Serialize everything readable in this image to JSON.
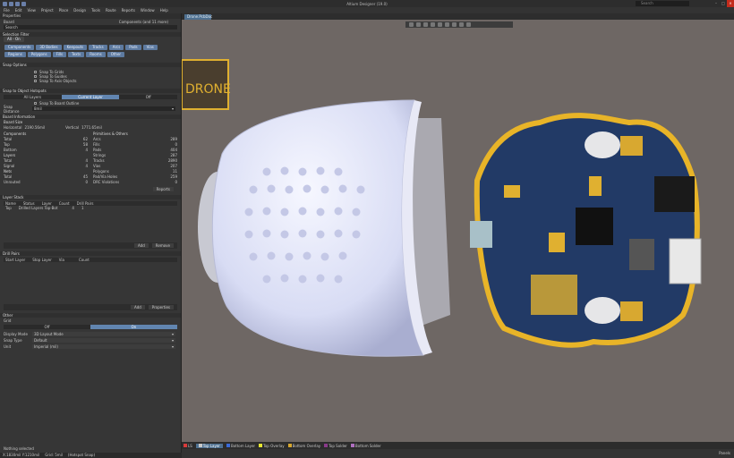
{
  "app": {
    "title": "Altium Designer (19.0)",
    "search_placeholder": "Search"
  },
  "menu": [
    "File",
    "Edit",
    "View",
    "Project",
    "Place",
    "Design",
    "Tools",
    "Route",
    "Reports",
    "Window",
    "Help"
  ],
  "panel": {
    "title": "Properties",
    "board_label": "Board",
    "components_count": "Components (and 11 more)",
    "search_placeholder": "Search",
    "selection_filter": {
      "title": "Selection Filter",
      "all_label": "All - On",
      "chips": [
        "Components",
        "3D Bodies",
        "Keepouts",
        "Tracks",
        "Arcs",
        "Pads",
        "Vias",
        "Regions",
        "Polygons",
        "Fills",
        "Texts",
        "Rooms",
        "Other"
      ]
    },
    "snap": {
      "title": "Snap Options",
      "options": [
        "Snap To Grids",
        "Snap To Guides",
        "Snap To Axis Objects"
      ]
    },
    "snap_objects": {
      "title": "Snap to Object Hotspots",
      "segments": [
        "All Layers",
        "Current Layer",
        "Off"
      ],
      "snap_board": "Snap To Board Outline",
      "snap_distance_label": "Snap Distance",
      "snap_distance": "8mil"
    },
    "board_info": {
      "title": "Board Information",
      "size_title": "Board Size",
      "horizontal_label": "Horizontal",
      "horizontal": "2190.56mil",
      "vertical_label": "Vertical",
      "vertical": "1771.65mil",
      "components_title": "Components",
      "components": [
        [
          "Total",
          "62"
        ],
        [
          "Top",
          "58"
        ],
        [
          "Bottom",
          "4"
        ]
      ],
      "layers_title": "Layers",
      "layers": [
        [
          "Total",
          "4"
        ],
        [
          "Signal",
          "4"
        ]
      ],
      "nets_title": "Nets",
      "nets": [
        [
          "Total",
          "45"
        ],
        [
          "Unrouted",
          "0"
        ]
      ],
      "primitives_title": "Primitives & Others",
      "primitives": [
        [
          "Arcs",
          "289"
        ],
        [
          "Fills",
          "0"
        ],
        [
          "Pads",
          "404"
        ],
        [
          "Strings",
          "287"
        ],
        [
          "Tracks",
          "2890"
        ],
        [
          "Vias",
          "207"
        ],
        [
          "Polygons",
          "11"
        ],
        [
          "Pad/Via Holes",
          "259"
        ],
        [
          "DRC Violations",
          "0"
        ]
      ],
      "report_button": "Reports"
    },
    "layers_table": {
      "title": "Layer Stack",
      "headers": [
        "Name",
        "Status",
        "Layer",
        "Count",
        "Drill Pairs"
      ],
      "rows": [
        [
          "Top",
          "Drilled Layers Top-Bot",
          "",
          "4",
          "1"
        ]
      ],
      "buttons": [
        "Add",
        "Remove"
      ]
    },
    "drill_table": {
      "title": "Drill Pairs",
      "headers": [
        "Start Layer",
        "Stop Layer",
        "Via",
        "",
        "Count"
      ],
      "buttons": [
        "Add",
        "Properties"
      ]
    },
    "other": {
      "title": "Other",
      "grid_label": "Grid",
      "segments": [
        "Off",
        "On"
      ],
      "fields": [
        [
          "Display Mode",
          "3D Layout Mode"
        ],
        [
          "Snap Type",
          "Default"
        ],
        [
          "Unit",
          "Imperial (mil)"
        ]
      ]
    },
    "nothing_selected": "Nothing selected",
    "status": [
      "X:1830mil Y:1210mil",
      "Grid: 5mil",
      "(Hotspot Snap)"
    ]
  },
  "document": {
    "tab": "Drone.PcbDoc",
    "logo_text": "DRONE",
    "layers": [
      {
        "name": "LS",
        "color": "#d83a3a"
      },
      {
        "name": "Top Layer",
        "color": "#c8c8c8"
      },
      {
        "name": "Bottom Layer",
        "color": "#3a6ad8"
      },
      {
        "name": "Top Overlay",
        "color": "#e6e632"
      },
      {
        "name": "Bottom Overlay",
        "color": "#d8a830"
      },
      {
        "name": "Top Solder",
        "color": "#8a3a8a"
      },
      {
        "name": "Bottom Solder",
        "color": "#b070c0"
      }
    ],
    "panels_button": "Panels"
  }
}
